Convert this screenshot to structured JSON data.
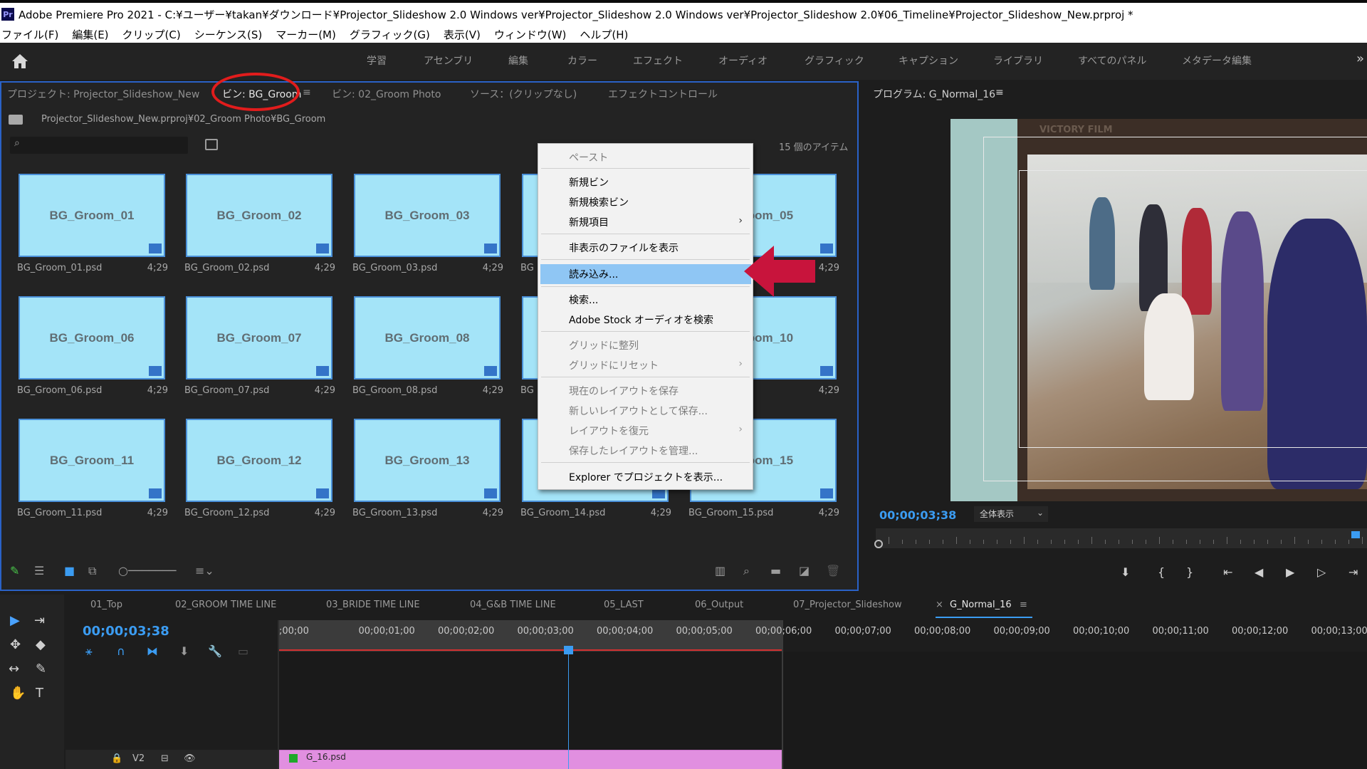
{
  "titlebar": {
    "logo": "Pr",
    "title": "Adobe Premiere Pro 2021 - C:¥ユーザー¥takan¥ダウンロード¥Projector_Slideshow 2.0 Windows ver¥Projector_Slideshow 2.0 Windows ver¥Projector_Slideshow 2.0¥06_Timeline¥Projector_Slideshow_New.prproj *"
  },
  "menu": [
    "ファイル(F)",
    "編集(E)",
    "クリップ(C)",
    "シーケンス(S)",
    "マーカー(M)",
    "グラフィック(G)",
    "表示(V)",
    "ウィンドウ(W)",
    "ヘルプ(H)"
  ],
  "workspaces": [
    "学習",
    "アセンブリ",
    "編集",
    "カラー",
    "エフェクト",
    "オーディオ",
    "グラフィック",
    "キャプション",
    "ライブラリ",
    "すべてのパネル",
    "メタデータ編集"
  ],
  "workspace_more": "»",
  "project_panel": {
    "tabs": [
      "プロジェクト: Projector_Slideshow_New",
      "ビン: BG_Groom",
      "ビン: 02_Groom Photo",
      "ソース：(クリップなし)",
      "エフェクトコントロール"
    ],
    "tab_menu_icon": "≡",
    "path": "Projector_Slideshow_New.prproj¥02_Groom Photo¥BG_Groom",
    "item_count": "15 個のアイテム",
    "items": [
      {
        "label": "BG_Groom_01",
        "file": "BG_Groom_01.psd",
        "dur": "4;29"
      },
      {
        "label": "BG_Groom_02",
        "file": "BG_Groom_02.psd",
        "dur": "4;29"
      },
      {
        "label": "BG_Groom_03",
        "file": "BG_Groom_03.psd",
        "dur": "4;29"
      },
      {
        "label": "",
        "file": "BG",
        "dur": ""
      },
      {
        "label": "Groom_05",
        "file": "",
        "dur": "4;29"
      },
      {
        "label": "BG_Groom_06",
        "file": "BG_Groom_06.psd",
        "dur": "4;29"
      },
      {
        "label": "BG_Groom_07",
        "file": "BG_Groom_07.psd",
        "dur": "4;29"
      },
      {
        "label": "BG_Groom_08",
        "file": "BG_Groom_08.psd",
        "dur": "4;29"
      },
      {
        "label": "",
        "file": "BG",
        "dur": ""
      },
      {
        "label": "Groom_10",
        "file": "psd",
        "dur": "4;29"
      },
      {
        "label": "BG_Groom_11",
        "file": "BG_Groom_11.psd",
        "dur": "4;29"
      },
      {
        "label": "BG_Groom_12",
        "file": "BG_Groom_12.psd",
        "dur": "4;29"
      },
      {
        "label": "BG_Groom_13",
        "file": "BG_Groom_13.psd",
        "dur": "4;29"
      },
      {
        "label": "",
        "file": "BG_Groom_14.psd",
        "dur": "4;29"
      },
      {
        "label": "Groom_15",
        "file": "BG_Groom_15.psd",
        "dur": "4;29"
      }
    ]
  },
  "context_menu": {
    "items": [
      {
        "label": "ペースト",
        "disabled": true
      },
      {
        "label": "新規ビン",
        "disabled": false
      },
      {
        "label": "新規検索ビン",
        "disabled": false
      },
      {
        "label": "新規項目",
        "disabled": false,
        "submenu": true
      },
      {
        "label": "非表示のファイルを表示",
        "disabled": false
      },
      {
        "label": "読み込み...",
        "disabled": false,
        "highlighted": true
      },
      {
        "label": "検索...",
        "disabled": false
      },
      {
        "label": "Adobe Stock オーディオを検索",
        "disabled": false
      },
      {
        "label": "グリッドに整列",
        "disabled": true
      },
      {
        "label": "グリッドにリセット",
        "disabled": true,
        "submenu": true
      },
      {
        "label": "現在のレイアウトを保存",
        "disabled": true
      },
      {
        "label": "新しいレイアウトとして保存...",
        "disabled": true
      },
      {
        "label": "レイアウトを復元",
        "disabled": true,
        "submenu": true
      },
      {
        "label": "保存したレイアウトを管理...",
        "disabled": true
      },
      {
        "label": "Explorer でプロジェクトを表示...",
        "disabled": false
      }
    ],
    "submenu_glyph": "›"
  },
  "program_monitor": {
    "title": "プログラム: G_Normal_16",
    "menu_icon": "≡",
    "watermark": "VICTORY FILM",
    "timecode": "00;00;03;38",
    "zoom": "全体表示",
    "zoom_chevron": "⌄",
    "transport": [
      "⬇",
      "{",
      "}",
      "⇤",
      "◀",
      "▶",
      "▷",
      "⇥"
    ]
  },
  "timeline": {
    "sequence_tabs": [
      "01_Top",
      "02_GROOM TIME LINE",
      "03_BRIDE TIME LINE",
      "04_G&B TIME LINE",
      "05_LAST",
      "06_Output",
      "07_Projector_Slideshow",
      "G_Normal_16"
    ],
    "close_glyph": "×",
    "menu_icon": "≡",
    "timecode": "00;00;03;38",
    "ruler": [
      ";00;00",
      "00;00;01;00",
      "00;00;02;00",
      "00;00;03;00",
      "00;00;04;00",
      "00;00;05;00",
      "00;00;06;00",
      "00;00;07;00",
      "00;00;08;00",
      "00;00;09;00",
      "00;00;10;00",
      "00;00;11;00",
      "00;00;12;00",
      "00;00;13;00"
    ],
    "track": "V2",
    "clip": "G_16.psd"
  },
  "tools": [
    "▶",
    "⇥",
    "✥",
    "◆",
    "↔",
    "✎",
    "✋",
    "T"
  ],
  "colors": {
    "accent": "#3b9cf2",
    "thumb": "#a4e4f8",
    "clip": "#e18fe0",
    "highlight": "#8fc6f4",
    "annotation": "#e11c1c",
    "arrow": "#c8143c"
  }
}
